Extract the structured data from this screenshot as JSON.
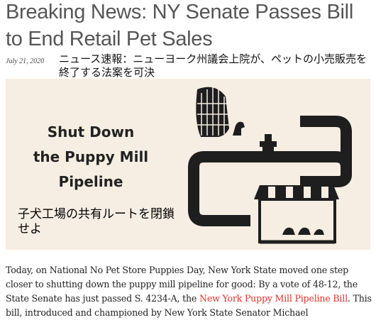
{
  "article": {
    "title": "Breaking News: NY Senate Passes Bill to End Retail Pet Sales",
    "date": "July 21, 2020",
    "title_translation": "ニュース速報：ニューヨーク州議会上院が、ペットの小売販売を終了する法案を可決",
    "hero": {
      "heading_lines": [
        "Shut Down",
        "the Puppy Mill",
        "Pipeline"
      ],
      "translation": "子犬工場の共有ルートを閉鎖せよ",
      "background": "#f6eee2"
    },
    "body_before_link": "Today, on National No Pet Store Puppies Day, New York State moved one step closer to shutting down the puppy mill pipeline for good: By a vote of 48-12, the State Senate has just passed S. 4234-A, the ",
    "link_text": "New York Puppy Mill Pipeline Bill",
    "body_after_link": ". This bill, introduced and championed by New York State Senator Michael",
    "link_color": "#e0322b"
  }
}
